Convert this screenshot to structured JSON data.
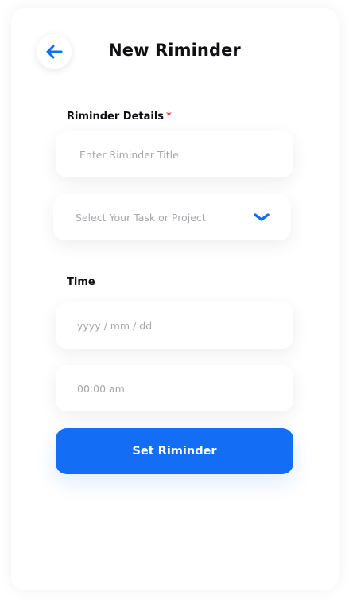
{
  "header": {
    "title": "New Riminder",
    "back_icon": "arrow-left-icon",
    "accent_color": "#136ef5"
  },
  "details": {
    "label": "Riminder Details",
    "required_mark": "*",
    "title_placeholder": "Enter Riminder Title",
    "task_select_placeholder": "Select Your Task or Project",
    "select_icon": "chevron-down-icon"
  },
  "time": {
    "label": "Time",
    "date_placeholder": "yyyy / mm / dd",
    "time_placeholder": "00:00 am"
  },
  "actions": {
    "submit_label": "Set Riminder",
    "submit_color": "#136ef5"
  }
}
